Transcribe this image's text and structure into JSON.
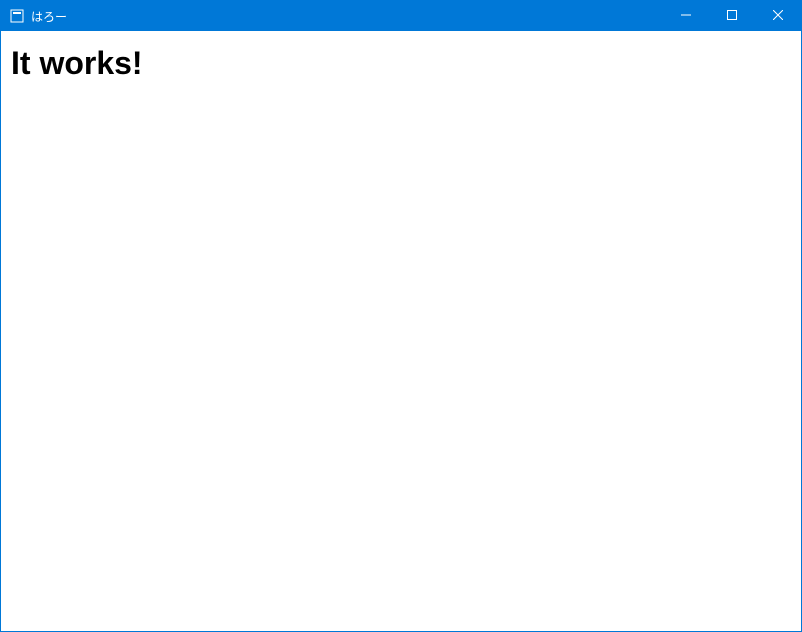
{
  "window": {
    "title": "はろー"
  },
  "content": {
    "heading": "It works!"
  }
}
